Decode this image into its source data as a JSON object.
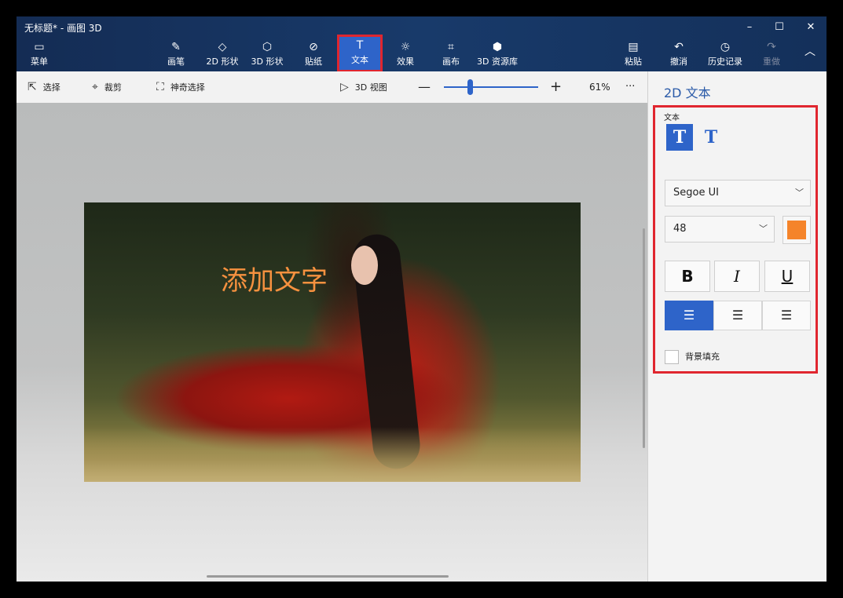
{
  "window": {
    "title": "无标题* - 画图 3D"
  },
  "ribbon": {
    "menu": "菜单",
    "items": [
      {
        "label": "画笔",
        "icon": "brush-icon"
      },
      {
        "label": "2D 形状",
        "icon": "2d-shapes-icon"
      },
      {
        "label": "3D 形状",
        "icon": "3d-shapes-icon"
      },
      {
        "label": "贴纸",
        "icon": "stickers-icon"
      },
      {
        "label": "文本",
        "icon": "text-icon"
      },
      {
        "label": "效果",
        "icon": "effects-icon"
      },
      {
        "label": "画布",
        "icon": "canvas-icon"
      },
      {
        "label": "3D 资源库",
        "icon": "3d-library-icon"
      }
    ],
    "right": [
      {
        "label": "粘贴",
        "icon": "paste-icon"
      },
      {
        "label": "撤消",
        "icon": "undo-icon"
      },
      {
        "label": "历史记录",
        "icon": "history-icon"
      },
      {
        "label": "重做",
        "icon": "redo-icon"
      }
    ]
  },
  "toolbar": {
    "select": "选择",
    "crop": "裁剪",
    "magic_select": "神奇选择",
    "view3d": "3D 视图",
    "zoom": "61%",
    "more": "···"
  },
  "canvas": {
    "overlay_text": "添加文字"
  },
  "panel": {
    "title": "2D 文本",
    "section_label": "文本",
    "font": "Segoe UI",
    "size": "48",
    "color": "#f5842a",
    "bold": "B",
    "italic": "I",
    "underline": "U",
    "background_fill": "背景填充"
  }
}
